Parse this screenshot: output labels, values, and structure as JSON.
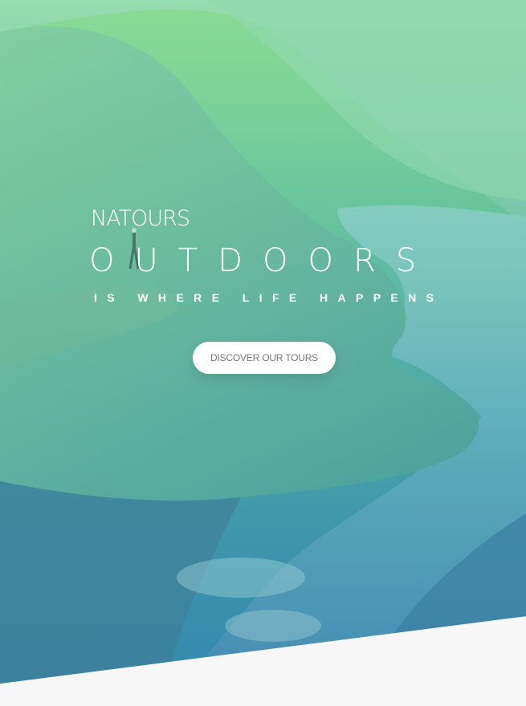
{
  "hero": {
    "logo_text": "NATOURS",
    "heading_main": "OUTDOORS",
    "heading_sub": "IS WHERE LIFE HAPPENS",
    "cta_label": "DISCOVER OUR TOURS"
  },
  "colors": {
    "gradient_top": "#7dd56f",
    "gradient_bottom": "#28b485",
    "section_background": "#f7f7f7",
    "button_background": "#ffffff",
    "button_text": "#777777"
  }
}
